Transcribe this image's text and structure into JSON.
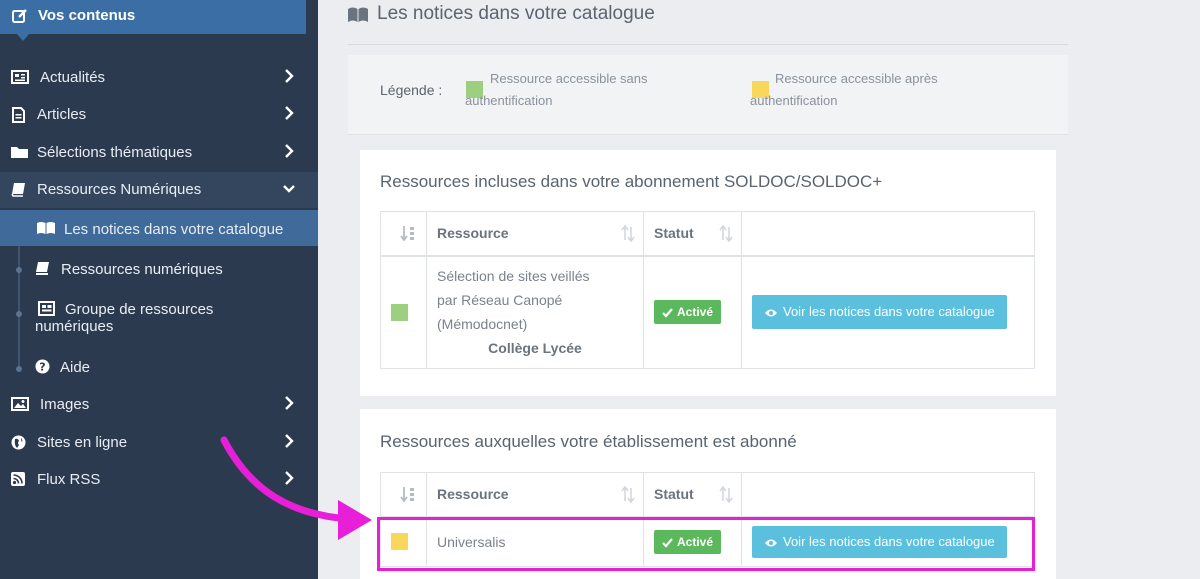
{
  "sidebar": {
    "header": "Vos contenus",
    "items": [
      {
        "label": "Actualités"
      },
      {
        "label": "Articles"
      },
      {
        "label": "Sélections thématiques"
      },
      {
        "label": "Ressources Numériques"
      }
    ],
    "subitems": [
      {
        "label": "Les notices dans votre catalogue"
      },
      {
        "label": "Ressources numériques"
      },
      {
        "label": "Groupe de ressources",
        "label2": "numériques"
      },
      {
        "label": "Aide"
      }
    ],
    "items_after": [
      {
        "label": "Images"
      },
      {
        "label": "Sites en ligne"
      },
      {
        "label": "Flux RSS"
      }
    ]
  },
  "main": {
    "page_title": "Les notices dans votre catalogue",
    "legend": {
      "label": "Légende :",
      "green_text": "Ressource accessible sans authentification",
      "yellow_text": "Ressource accessible après authentification"
    },
    "panel1": {
      "title": "Ressources incluses dans votre abonnement SOLDOC/SOLDOC+",
      "col_resource": "Ressource",
      "col_status": "Statut",
      "row": {
        "lines": [
          "Sélection de sites veillés",
          "par Réseau Canopé",
          "(Mémodocnet)"
        ],
        "level": "Collège Lycée",
        "status": "Activé",
        "action": "Voir les notices dans votre catalogue"
      }
    },
    "panel2": {
      "title": "Ressources auxquelles votre établissement est abonné",
      "col_resource": "Ressource",
      "col_status": "Statut",
      "row": {
        "name": "Universalis",
        "status": "Activé",
        "action": "Voir les notices dans votre catalogue"
      }
    }
  },
  "colors": {
    "sidebar_bg": "#2b3a4f",
    "sidebar_active": "#3f6a99",
    "green_swatch": "#9ccf7f",
    "yellow_swatch": "#f9d65c",
    "badge_green": "#5cb85c",
    "button_blue": "#5bc0de",
    "highlight_magenta": "#e81fd8"
  },
  "icons": {
    "header": "edit-icon",
    "actualites": "newspaper-icon",
    "articles": "file-icon",
    "selections": "folder-icon",
    "ressources": "book-icon",
    "notices": "open-book-icon",
    "ressources_num": "books-icon",
    "groupe": "grid-icon",
    "aide": "question-circle-icon",
    "images": "picture-icon",
    "sites": "globe-icon",
    "rss": "rss-icon"
  }
}
